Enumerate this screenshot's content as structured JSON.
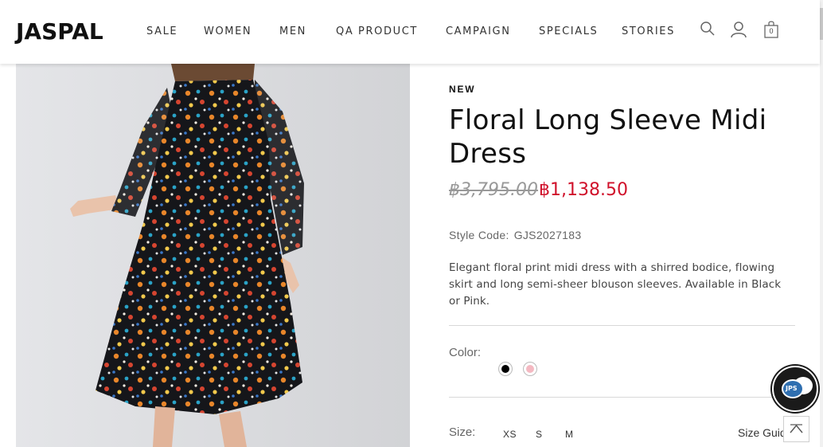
{
  "brand": {
    "logo_text": "JASPAL"
  },
  "nav": {
    "items": [
      "SALE",
      "WOMEN",
      "MEN",
      "QA PRODUCT",
      "CAMPAIGN",
      "SPECIALS",
      "STORIES"
    ]
  },
  "header_icons": {
    "search": "search-icon",
    "account": "user-icon",
    "bag": "shopping-bag-icon",
    "bag_count": "0"
  },
  "product": {
    "badge": "NEW",
    "title": "Floral Long Sleeve Midi Dress",
    "price_original": "฿3,795.00",
    "price_sale": "฿1,138.50",
    "style_code_label": "Style Code:",
    "style_code": "GJS2027183",
    "description": "Elegant floral print midi dress with a shirred bodice, flowing skirt and long semi-sheer blouson sleeves. Available in Black or Pink.",
    "color_label": "Color:",
    "colors": [
      {
        "name": "Black",
        "hex": "#000000"
      },
      {
        "name": "Pink",
        "hex": "#f4b9c2"
      }
    ],
    "size_label": "Size:",
    "sizes": [
      "XS",
      "S",
      "M"
    ],
    "size_guide": "Size Guide"
  },
  "floating": {
    "chat_text": "JPS",
    "chat_icon": "chat-bubble-icon",
    "back_to_top_icon": "arrow-up-icon"
  },
  "colors": {
    "accent_sale": "#d0112b",
    "text_dark": "#111111",
    "muted": "#999999"
  }
}
